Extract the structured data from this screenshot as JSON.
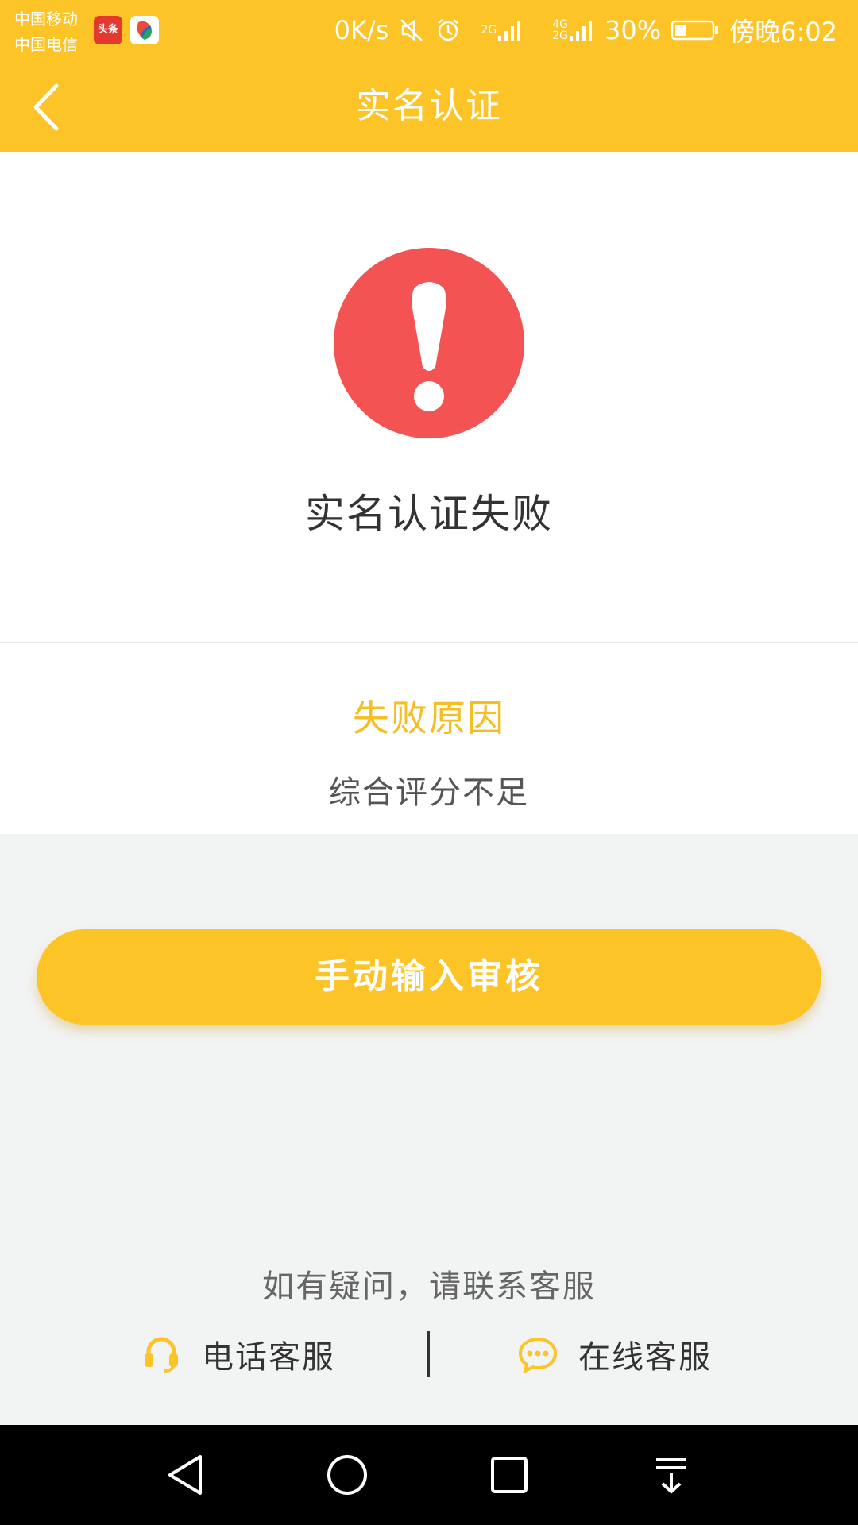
{
  "status_bar": {
    "carriers": [
      "中国移动",
      "中国电信"
    ],
    "app_badge": "头条",
    "net_speed": "0K/s",
    "sim1_tag": "2G",
    "sim2_tag_top": "4G",
    "sim2_tag_bottom": "2G",
    "battery_percent": "30%",
    "time": "傍晚6:02"
  },
  "nav": {
    "title": "实名认证"
  },
  "result": {
    "title": "实名认证失败"
  },
  "reason": {
    "heading": "失败原因",
    "text": "综合评分不足"
  },
  "actions": {
    "manual_review_label": "手动输入审核"
  },
  "help": {
    "text": "如有疑问，请联系客服",
    "phone_label": "电话客服",
    "online_label": "在线客服"
  },
  "colors": {
    "brand_yellow": "#fdc427",
    "alert_red": "#f45353",
    "reason_yellow": "#f4bf24"
  }
}
